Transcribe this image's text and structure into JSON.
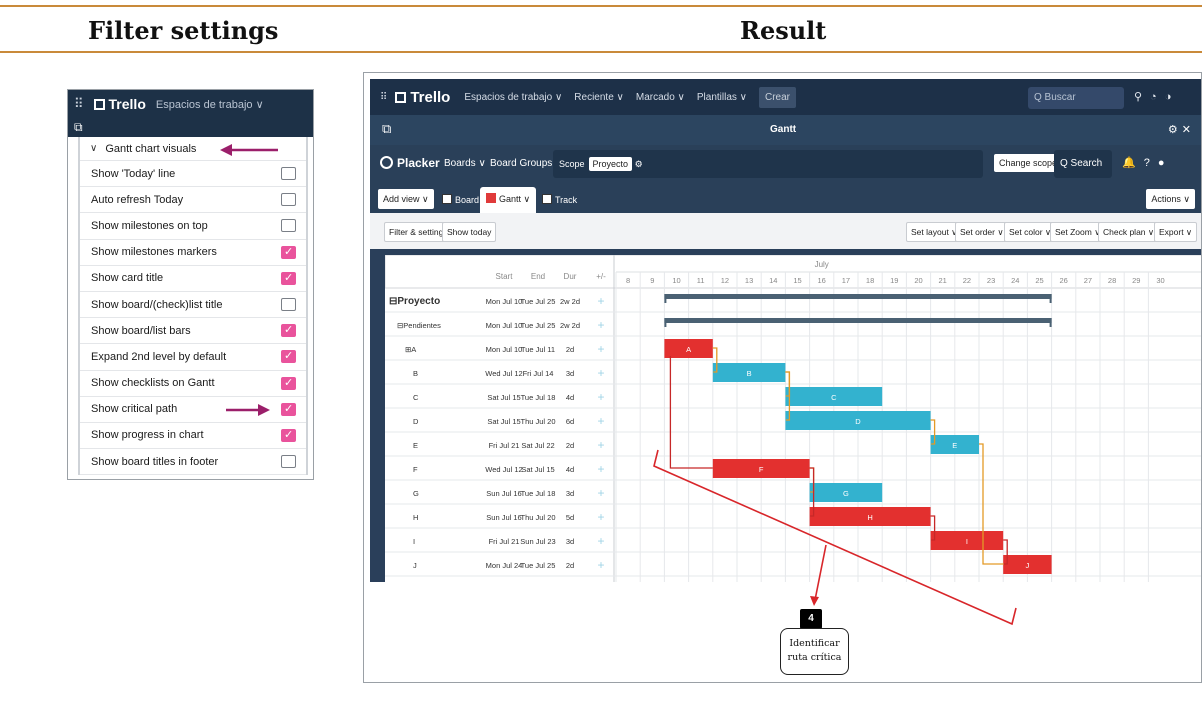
{
  "header": {
    "left_title": "Filter settings",
    "right_title": "Result"
  },
  "filter_panel": {
    "nav": {
      "app_name": "Trello",
      "workspaces_menu": "Espacios de trabajo"
    },
    "section_label": "Gantt chart visuals",
    "options": [
      {
        "label": "Show 'Today' line",
        "checked": false
      },
      {
        "label": "Auto refresh Today",
        "checked": false
      },
      {
        "label": "Show milestones on top",
        "checked": false
      },
      {
        "label": "Show milestones markers",
        "checked": true
      },
      {
        "label": "Show card title",
        "checked": true
      },
      {
        "label": "Show board/(check)list title",
        "checked": false
      },
      {
        "label": "Show board/list bars",
        "checked": true
      },
      {
        "label": "Expand 2nd level by default",
        "checked": true
      },
      {
        "label": "Show checklists on Gantt",
        "checked": true
      },
      {
        "label": "Show critical path",
        "checked": true
      },
      {
        "label": "Show progress in chart",
        "checked": true
      },
      {
        "label": "Show board titles in footer",
        "checked": false
      }
    ],
    "checked_color": "#e9539c",
    "arrow_color": "#9b1f6a"
  },
  "result": {
    "trello_bar": {
      "app_name": "Trello",
      "menus": [
        "Espacios de trabajo ∨",
        "Reciente ∨",
        "Marcado ∨",
        "Plantillas ∨"
      ],
      "create": "Crear",
      "search_placeholder": "Q Buscar"
    },
    "window_title": "Gantt",
    "placker_bar": {
      "brand": "Placker",
      "boards": "Boards ∨",
      "board_groups": "Board Groups ∨",
      "scope_label": "Scope",
      "scope_value": "Proyecto",
      "change_scope": "Change scope",
      "search": "Q Search"
    },
    "views": {
      "add_view": "Add view ∨",
      "board": "Board",
      "gantt": "Gantt ∨",
      "track": "Track",
      "actions": "Actions ∨"
    },
    "toolbar": {
      "filter": "Filter & settings",
      "show_today": "Show today",
      "set_layout": "Set layout ∨",
      "set_order": "Set order ∨",
      "set_color": "Set color ∨",
      "set_zoom": "Set Zoom ∨",
      "check_plan": "Check plan ∨",
      "export": "Export ∨"
    },
    "gantt": {
      "columns": {
        "start": "Start",
        "end": "End",
        "dur": "Dur",
        "add": "+/-"
      },
      "month": "July",
      "days": [
        "8",
        "9",
        "10",
        "11",
        "12",
        "13",
        "14",
        "15",
        "16",
        "17",
        "18",
        "19",
        "20",
        "21",
        "22",
        "23",
        "24",
        "25",
        "26",
        "27",
        "28",
        "29",
        "30"
      ],
      "rows": [
        {
          "name": "⊟Proyecto",
          "start": "Mon Jul 10",
          "end": "Tue Jul 25",
          "dur": "2w 2d",
          "level": 0,
          "bar": {
            "type": "summary",
            "from": 10,
            "to": 26
          }
        },
        {
          "name": "⊟Pendientes",
          "start": "Mon Jul 10",
          "end": "Tue Jul 25",
          "dur": "2w 2d",
          "level": 1,
          "bar": {
            "type": "summary",
            "from": 10,
            "to": 26
          }
        },
        {
          "name": "⊞A",
          "start": "Mon Jul 10",
          "end": "Tue Jul 11",
          "dur": "2d",
          "level": 2,
          "bar": {
            "type": "critical",
            "from": 10,
            "to": 12,
            "label": "A"
          }
        },
        {
          "name": "B",
          "start": "Wed Jul 12",
          "end": "Fri Jul 14",
          "dur": "3d",
          "level": 3,
          "bar": {
            "type": "normal",
            "from": 12,
            "to": 15,
            "label": "B"
          }
        },
        {
          "name": "C",
          "start": "Sat Jul 15",
          "end": "Tue Jul 18",
          "dur": "4d",
          "level": 3,
          "bar": {
            "type": "normal",
            "from": 15,
            "to": 19,
            "label": "C"
          }
        },
        {
          "name": "D",
          "start": "Sat Jul 15",
          "end": "Thu Jul 20",
          "dur": "6d",
          "level": 3,
          "bar": {
            "type": "normal",
            "from": 15,
            "to": 21,
            "label": "D"
          }
        },
        {
          "name": "E",
          "start": "Fri Jul 21",
          "end": "Sat Jul 22",
          "dur": "2d",
          "level": 3,
          "bar": {
            "type": "normal",
            "from": 21,
            "to": 23,
            "label": "E"
          }
        },
        {
          "name": "F",
          "start": "Wed Jul 12",
          "end": "Sat Jul 15",
          "dur": "4d",
          "level": 3,
          "bar": {
            "type": "critical",
            "from": 12,
            "to": 16,
            "label": "F"
          }
        },
        {
          "name": "G",
          "start": "Sun Jul 16",
          "end": "Tue Jul 18",
          "dur": "3d",
          "level": 3,
          "bar": {
            "type": "normal",
            "from": 16,
            "to": 19,
            "label": "G"
          }
        },
        {
          "name": "H",
          "start": "Sun Jul 16",
          "end": "Thu Jul 20",
          "dur": "5d",
          "level": 3,
          "bar": {
            "type": "critical",
            "from": 16,
            "to": 21,
            "label": "H"
          }
        },
        {
          "name": "I",
          "start": "Fri Jul 21",
          "end": "Sun Jul 23",
          "dur": "3d",
          "level": 3,
          "bar": {
            "type": "critical",
            "from": 21,
            "to": 24,
            "label": "I"
          }
        },
        {
          "name": "J",
          "start": "Mon Jul 24",
          "end": "Tue Jul 25",
          "dur": "2d",
          "level": 3,
          "bar": {
            "type": "critical",
            "from": 24,
            "to": 26,
            "label": "J"
          }
        }
      ],
      "colors": {
        "critical": "#e3302f",
        "normal": "#33b2cf",
        "summary": "#4a6173",
        "link_critical": "#c62828",
        "link_normal": "#e39a27"
      }
    },
    "callout": {
      "number": "4",
      "line1": "Identificar",
      "line2": "ruta crítica",
      "color": "#d8262a"
    }
  }
}
